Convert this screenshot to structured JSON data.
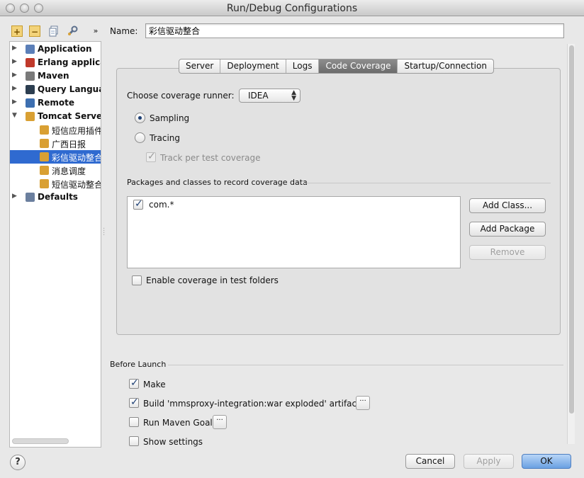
{
  "window": {
    "title": "Run/Debug Configurations"
  },
  "toolbar": {
    "add": "+",
    "remove": "−",
    "copy": "copy-icon",
    "edit": "wrench-icon",
    "more": "»"
  },
  "tree": {
    "items": [
      {
        "label": "Application",
        "bold": true,
        "arrow": "▶",
        "icon": "application-icon"
      },
      {
        "label": "Erlang application",
        "bold": true,
        "arrow": "▶",
        "icon": "erlang-icon"
      },
      {
        "label": "Maven",
        "bold": true,
        "arrow": "▶",
        "icon": "gear-icon"
      },
      {
        "label": "Query Language",
        "bold": true,
        "arrow": "▶",
        "icon": "query-icon"
      },
      {
        "label": "Remote",
        "bold": true,
        "arrow": "▶",
        "icon": "remote-icon"
      },
      {
        "label": "Tomcat Server",
        "bold": true,
        "arrow": "▼",
        "icon": "tomcat-icon"
      },
      {
        "label": "短信应用插件",
        "bold": false,
        "arrow": "",
        "icon": "tomcat-icon"
      },
      {
        "label": "广西日报",
        "bold": false,
        "arrow": "",
        "icon": "tomcat-icon"
      },
      {
        "label": "彩信驱动整合",
        "bold": false,
        "arrow": "",
        "icon": "tomcat-icon",
        "selected": true
      },
      {
        "label": "消息调度",
        "bold": false,
        "arrow": "",
        "icon": "tomcat-icon"
      },
      {
        "label": "短信驱动整合",
        "bold": false,
        "arrow": "",
        "icon": "tomcat-icon"
      },
      {
        "label": "Defaults",
        "bold": true,
        "arrow": "▶",
        "icon": "defaults-icon"
      }
    ]
  },
  "name": {
    "label": "Name:",
    "value": "彩信驱动整合"
  },
  "tabs": [
    {
      "label": "Server"
    },
    {
      "label": "Deployment"
    },
    {
      "label": "Logs"
    },
    {
      "label": "Code Coverage",
      "active": true
    },
    {
      "label": "Startup/Connection"
    }
  ],
  "coverage": {
    "runner_label": "Choose coverage runner:",
    "runner_value": "IDEA",
    "sampling": "Sampling",
    "tracing": "Tracing",
    "track_per_test": "Track per test coverage",
    "packages_label": "Packages and classes to record coverage data",
    "packages": [
      {
        "value": "com.*",
        "checked": true
      }
    ],
    "add_class": "Add Class...",
    "add_package": "Add Package",
    "remove": "Remove",
    "enable_test_folders": "Enable coverage in test folders"
  },
  "before_launch": {
    "label": "Before Launch",
    "make": "Make",
    "build": "Build 'mmsproxy-integration:war exploded' artifact",
    "run_maven": "Run Maven Goal",
    "show_settings": "Show settings",
    "dots": "···"
  },
  "footer": {
    "help": "?",
    "cancel": "Cancel",
    "apply": "Apply",
    "ok": "OK"
  },
  "colors": {
    "selection": "#2f6ad0",
    "default_button": "#6aa0e2"
  }
}
